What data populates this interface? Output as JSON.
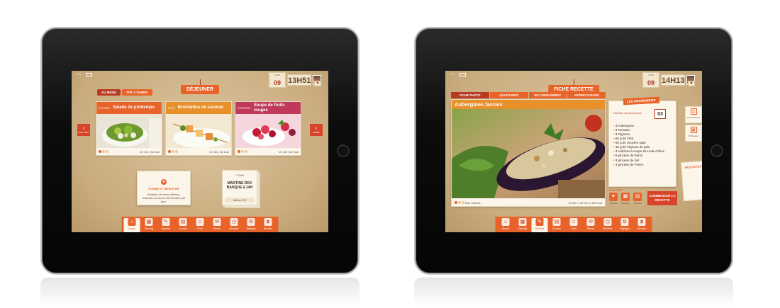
{
  "left_app": {
    "header_title": "DÉJEUNER",
    "date": {
      "month": "JOUR",
      "day": "09"
    },
    "time": "13H51",
    "tabs": [
      {
        "label": "AU MENU"
      },
      {
        "label": "TOP 3 YUMMY"
      }
    ],
    "prev_label": "PETIT DEJ",
    "next_label": "DINER",
    "cards": [
      {
        "category": "ENTRÉE",
        "name": "Salade de printemps",
        "info": "20 min | 84 kcal",
        "color": "#e8632a"
      },
      {
        "category": "PLAT",
        "name": "Brochettes de saumon",
        "info": "10 min | 58 kcal",
        "color": "#e8902a"
      },
      {
        "category": "DESSERT",
        "name": "Soupe de fruits rouges",
        "info": "15 min | 82 kcal",
        "color": "#c0395a"
      }
    ],
    "tip": {
      "title": "FORME ET BIEN ÊTRE",
      "text": "Adoptez de bons réflexes, marchez au moins 30 minutes par jour."
    },
    "note": {
      "date": "7 JUIN",
      "text": "MARTINE RDV BANQUE à 14H",
      "footer": "Mémo 2/3"
    }
  },
  "right_app": {
    "header_title": "FICHE RECETTE",
    "date": {
      "month": "JOUR",
      "day": "09"
    },
    "time": "14H13",
    "tabs": [
      {
        "label": "FICHE PHOTO"
      },
      {
        "label": "LES ÉTAPES"
      },
      {
        "label": "EN COMPLÉMENT"
      },
      {
        "label": "APPRÉCIATIONS"
      }
    ],
    "recipe_title": "Aubergines farcies",
    "recipe_cost": "Bon marché",
    "recipe_times": "15 min  1  30 min  1  405 kcal",
    "ingredients_title": "LES INGRÉDIENTS",
    "people_label": "Nombre de personnes",
    "people_count": "03",
    "ingredients": [
      "3  Aubergines",
      "3  Tomates",
      "3  Oignons",
      "60  g de Féta",
      "60  g de Gruyère rapé",
      "15  g de Pignons de pain",
      "3  cuillères à soupe de Huile d'olive",
      "6  pincées de Persil",
      "3  pincées de Sel",
      "3  pincées de Poivre"
    ],
    "add_label": "AJOUTER",
    "add_buttons": [
      {
        "label": "Favoris"
      },
      {
        "label": "Planning"
      },
      {
        "label": "Courses"
      }
    ],
    "start_label": "COMMENCER LA RECETTE",
    "side_tabs": [
      {
        "label": "Convertisseur"
      },
      {
        "label": "Ordinateur"
      }
    ],
    "mes_notes": "MES NOTES"
  },
  "toolbar_items": [
    {
      "label": "Accueil"
    },
    {
      "label": "Planning"
    },
    {
      "label": "Recettes"
    },
    {
      "label": "Courses"
    },
    {
      "label": "Profil"
    },
    {
      "label": "Mémos"
    },
    {
      "label": "Minuterie"
    },
    {
      "label": "Réglages"
    },
    {
      "label": "Minuteur"
    }
  ]
}
